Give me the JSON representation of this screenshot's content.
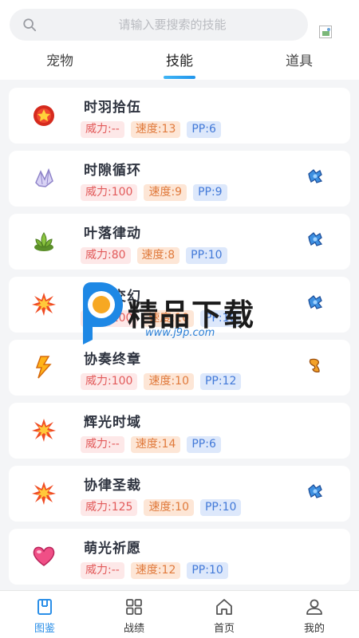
{
  "search": {
    "placeholder": "请输入要搜索的技能"
  },
  "tabs": [
    {
      "label": "宠物",
      "active": false
    },
    {
      "label": "技能",
      "active": true
    },
    {
      "label": "道具",
      "active": false
    }
  ],
  "skills": [
    {
      "name": "时羽拾伍",
      "power": "威力:--",
      "speed": "速度:13",
      "pp": "PP:6",
      "icon": "red-orb-star-icon",
      "type_icon": ""
    },
    {
      "name": "时隙循环",
      "power": "威力:100",
      "speed": "速度:9",
      "pp": "PP:9",
      "icon": "lavender-crystal-icon",
      "type_icon": "blue-mech-type-icon"
    },
    {
      "name": "叶落律动",
      "power": "威力:80",
      "speed": "速度:8",
      "pp": "PP:10",
      "icon": "green-leaf-icon",
      "type_icon": "blue-mech-type-icon"
    },
    {
      "name": "光之交幻",
      "power": "威力:100",
      "speed": "速度:10",
      "pp": "PP:10",
      "icon": "orange-burst-icon",
      "type_icon": "blue-mech-type-icon"
    },
    {
      "name": "协奏终章",
      "power": "威力:100",
      "speed": "速度:10",
      "pp": "PP:12",
      "icon": "lightning-bolt-icon",
      "type_icon": "orange-swirl-type-icon"
    },
    {
      "name": "辉光时域",
      "power": "威力:--",
      "speed": "速度:14",
      "pp": "PP:6",
      "icon": "orange-burst-icon",
      "type_icon": ""
    },
    {
      "name": "协律圣裁",
      "power": "威力:125",
      "speed": "速度:10",
      "pp": "PP:10",
      "icon": "orange-burst-icon",
      "type_icon": "blue-mech-type-icon"
    },
    {
      "name": "萌光祈愿",
      "power": "威力:--",
      "speed": "速度:12",
      "pp": "PP:10",
      "icon": "pink-heart-icon",
      "type_icon": ""
    }
  ],
  "watermark": {
    "text": "精品下载",
    "url": "www.j9p.com"
  },
  "bottom_nav": [
    {
      "label": "图鉴",
      "icon": "book-icon",
      "active": true
    },
    {
      "label": "战绩",
      "icon": "grid-icon",
      "active": false
    },
    {
      "label": "首页",
      "icon": "home-icon",
      "active": false
    },
    {
      "label": "我的",
      "icon": "user-icon",
      "active": false
    }
  ],
  "colors": {
    "accent": "#2b8fe8",
    "power_text": "#e25a5a",
    "speed_text": "#e07a3c",
    "pp_text": "#4279d8"
  }
}
